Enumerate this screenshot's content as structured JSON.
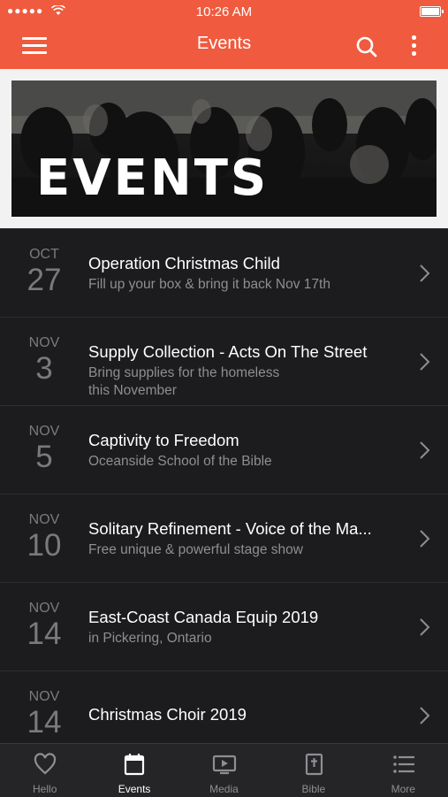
{
  "status_bar": {
    "signal": "●●●●●",
    "time": "10:26 AM"
  },
  "nav": {
    "title": "Events"
  },
  "banner": {
    "title": "EVENTS"
  },
  "events": [
    {
      "month": "OCT",
      "day": "27",
      "title": "Operation Christmas Child",
      "subtitle": "Fill up your box & bring it back Nov 17th"
    },
    {
      "month": "NOV",
      "day": "3",
      "title": "Supply Collection - Acts On The Street",
      "subtitle": "Bring supplies for the homeless",
      "subtitle2": "this November"
    },
    {
      "month": "NOV",
      "day": "5",
      "title": "Captivity to Freedom",
      "subtitle": "Oceanside School of the Bible"
    },
    {
      "month": "NOV",
      "day": "10",
      "title": "Solitary Refinement - Voice of the Ma...",
      "subtitle": "Free unique & powerful stage show"
    },
    {
      "month": "NOV",
      "day": "14",
      "title": "East-Coast Canada Equip 2019",
      "subtitle": "in Pickering, Ontario"
    },
    {
      "month": "NOV",
      "day": "14",
      "title": "Christmas Choir 2019",
      "subtitle": ""
    }
  ],
  "tabs": [
    {
      "label": "Hello",
      "icon": "heart-icon"
    },
    {
      "label": "Events",
      "icon": "calendar-icon",
      "active": true
    },
    {
      "label": "Media",
      "icon": "media-player-icon"
    },
    {
      "label": "Bible",
      "icon": "bible-icon"
    },
    {
      "label": "More",
      "icon": "list-icon"
    }
  ],
  "colors": {
    "accent": "#f05a3e",
    "background": "#1c1c1e",
    "tabbar": "#252527"
  }
}
